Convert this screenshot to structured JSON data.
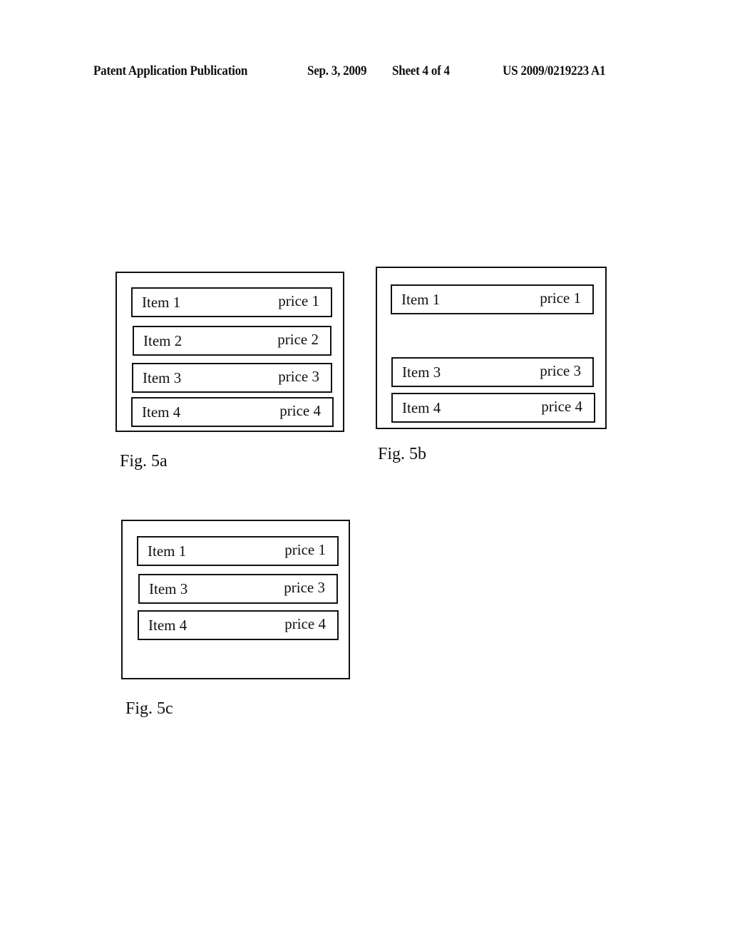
{
  "header": {
    "publication": "Patent Application Publication",
    "date": "Sep. 3, 2009",
    "sheet": "Sheet 4 of 4",
    "number": "US 2009/0219223 A1"
  },
  "figures": {
    "fig5a": {
      "caption": "Fig. 5a",
      "rows": [
        {
          "item": "Item 1",
          "price": "price 1"
        },
        {
          "item": "Item 2",
          "price": "price 2"
        },
        {
          "item": "Item 3",
          "price": "price 3"
        },
        {
          "item": "Item 4",
          "price": "price 4"
        }
      ]
    },
    "fig5b": {
      "caption": "Fig. 5b",
      "rows": [
        {
          "item": "Item 1",
          "price": "price 1"
        },
        {
          "item": "Item 3",
          "price": "price 3"
        },
        {
          "item": "Item 4",
          "price": "price 4"
        }
      ]
    },
    "fig5c": {
      "caption": "Fig. 5c",
      "rows": [
        {
          "item": "Item 1",
          "price": "price 1"
        },
        {
          "item": "Item 3",
          "price": "price 3"
        },
        {
          "item": "Item 4",
          "price": "price 4"
        }
      ]
    }
  }
}
